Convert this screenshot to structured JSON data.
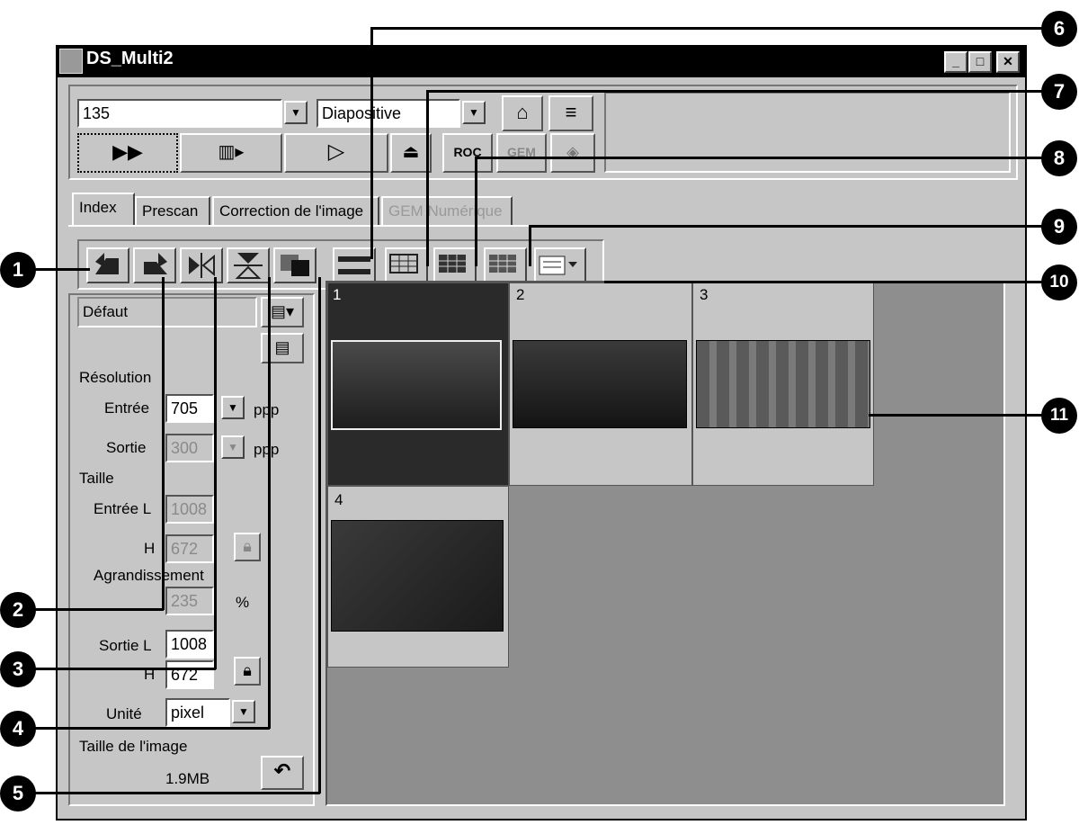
{
  "window": {
    "title": "DS_Multi2",
    "controls": [
      "_",
      "□",
      "✕"
    ]
  },
  "toolbar": {
    "film_format": "135",
    "film_type": "Diapositive",
    "top_buttons": [
      "settings-icon",
      "film-strip-icon"
    ],
    "scan_buttons": [
      "index-scan-icon",
      "prescan-icon",
      "scan-icon",
      "eject-icon",
      "roc-icon",
      "gem-icon",
      "ice-icon"
    ]
  },
  "tabs": [
    "Index",
    "Prescan",
    "Correction de l'image",
    "GEM Numérique"
  ],
  "tools": [
    "rotate-left-icon",
    "rotate-right-icon",
    "flip-horizontal-icon",
    "flip-vertical-icon",
    "negative-icon",
    "select-frames-icon",
    "select-all-icon",
    "select-inverse-icon",
    "deselect-icon",
    "menu-icon"
  ],
  "settings": {
    "preset": "Défaut",
    "resolution_label": "Résolution",
    "input_label": "Entrée",
    "input_value": "705",
    "output_label": "Sortie",
    "output_value": "300",
    "dpi_unit": "ppp",
    "size_label": "Taille",
    "input_w_label": "Entrée L",
    "input_w": "1008",
    "h_label": "H",
    "input_h": "672",
    "enlargement_label": "Agrandissement",
    "enlargement": "235",
    "percent": "%",
    "output_w_label": "Sortie L",
    "output_w": "1008",
    "output_h": "672",
    "unit_label": "Unité",
    "unit": "pixel",
    "image_size_label": "Taille de l'image",
    "image_size": "1.9MB"
  },
  "thumbnails": [
    {
      "number": "1",
      "selected": true
    },
    {
      "number": "2",
      "selected": false
    },
    {
      "number": "3",
      "selected": false
    },
    {
      "number": "4",
      "selected": false
    }
  ],
  "callouts": [
    "1",
    "2",
    "3",
    "4",
    "5",
    "6",
    "7",
    "8",
    "9",
    "10",
    "11"
  ],
  "colors": {
    "window_bg": "#c6c6c6",
    "titlebar": "#000000",
    "thumb_area": "#8e8e8e",
    "selected_cell": "#2a2a2a"
  }
}
